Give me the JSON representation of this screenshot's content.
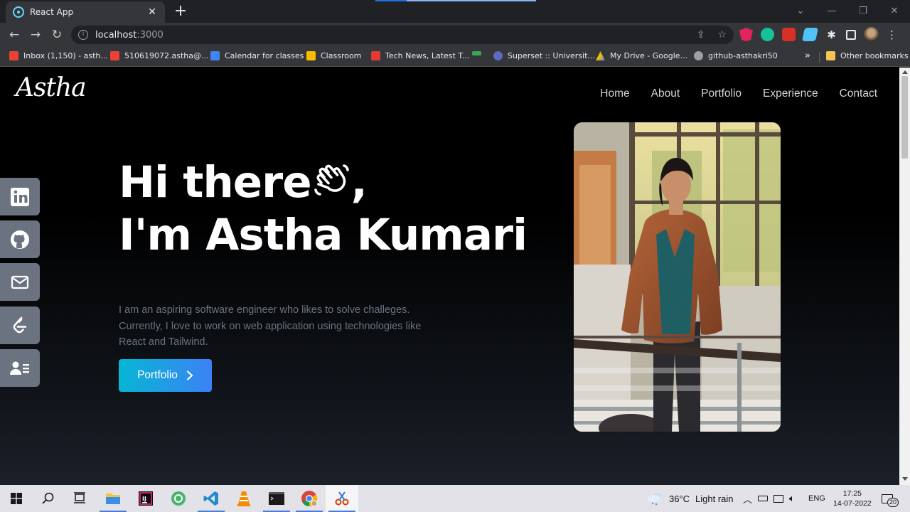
{
  "browser": {
    "tab_title": "React App",
    "url_host": "localhost",
    "url_port": ":3000",
    "bookmarks": [
      {
        "label": "Inbox (1,150) - asth...",
        "color": "#ea4335"
      },
      {
        "label": "510619072.astha@...",
        "color": "#ea4335"
      },
      {
        "label": "Calendar for classes",
        "color": "#4285f4"
      },
      {
        "label": "Classroom",
        "color": "#fbbc04"
      },
      {
        "label": "Tech News, Latest T...",
        "color": "#e53935"
      },
      {
        "label": "",
        "color": "#34a853"
      },
      {
        "label": "Superset :: Universit...",
        "color": "#5c6bc0"
      },
      {
        "label": "My Drive - Google...",
        "color": "#34a853"
      },
      {
        "label": "github-asthakri50",
        "color": "#9aa0a6"
      }
    ],
    "other_bookmarks": "Other bookmarks"
  },
  "page": {
    "logo": "Astha",
    "nav": [
      "Home",
      "About",
      "Portfolio",
      "Experience",
      "Contact"
    ],
    "hero": {
      "line1": "Hi there",
      "line1_suffix": ",",
      "line2": "I'm Astha Kumari",
      "description": "I am an aspiring software engineer who likes to solve challeges. Currently, I love to work on web application using technologies like React and Tailwind.",
      "cta_label": "Portfolio"
    },
    "social_icons": [
      "linkedin-icon",
      "github-icon",
      "mail-icon",
      "leetcode-icon",
      "resume-icon"
    ]
  },
  "taskbar": {
    "weather_temp": "36°C",
    "weather_text": "Light rain",
    "language": "ENG",
    "time": "17:25",
    "date": "14-07-2022",
    "notification_count": "20"
  }
}
